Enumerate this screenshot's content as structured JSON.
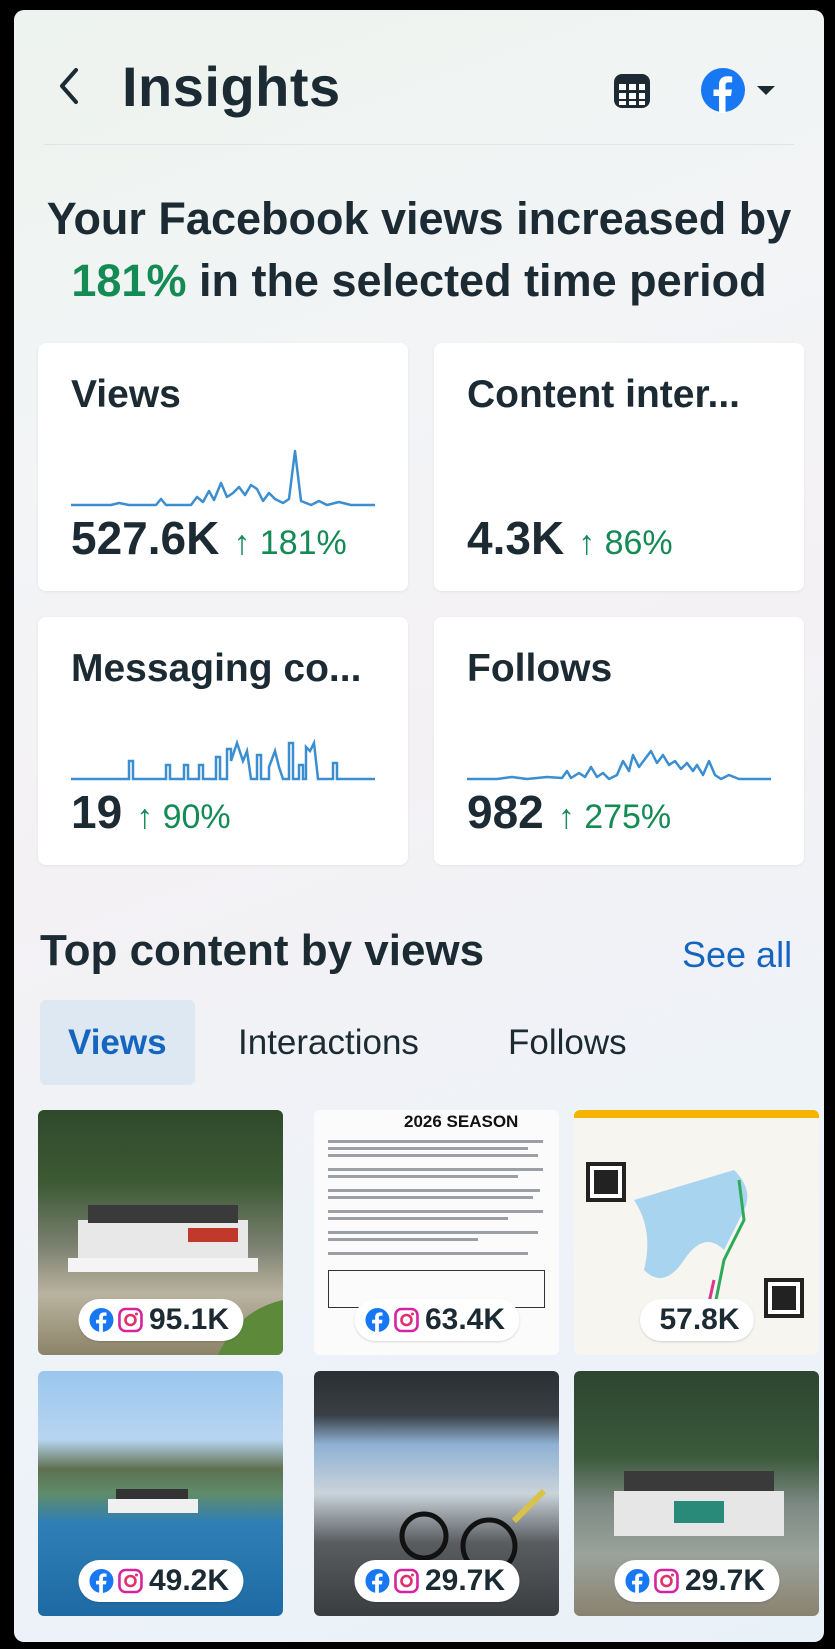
{
  "header": {
    "title": "Insights",
    "icons": [
      "back-chevron-icon",
      "calendar-icon",
      "facebook-icon",
      "caret-down-icon"
    ]
  },
  "headline": {
    "prefix": "Your Facebook views increased by",
    "percent": "181%",
    "suffix": "in the selected time period"
  },
  "metrics": [
    {
      "label": "Views",
      "value": "527.6K",
      "change": "↑ 181%"
    },
    {
      "label": "Content inter...",
      "value": "4.3K",
      "change": "↑ 86%"
    },
    {
      "label": "Messaging co...",
      "value": "19",
      "change": "↑ 90%"
    },
    {
      "label": "Follows",
      "value": "982",
      "change": "↑ 275%"
    }
  ],
  "top_content": {
    "title": "Top content by views",
    "see_all": "See all",
    "tabs": [
      "Views",
      "Interactions",
      "Follows"
    ],
    "active_tab": "Views",
    "items": [
      {
        "views": "95.1K",
        "platforms": [
          "facebook",
          "instagram"
        ]
      },
      {
        "views": "63.4K",
        "platforms": [
          "facebook",
          "instagram"
        ],
        "doc_heading": "2026 SEASON"
      },
      {
        "views": "57.8K",
        "platforms": []
      },
      {
        "views": "49.2K",
        "platforms": [
          "facebook",
          "instagram"
        ]
      },
      {
        "views": "29.7K",
        "platforms": [
          "facebook",
          "instagram"
        ]
      },
      {
        "views": "29.7K",
        "platforms": [
          "facebook",
          "instagram"
        ]
      }
    ]
  },
  "colors": {
    "positive": "#148a54",
    "link": "#1565c0",
    "text": "#1c2b33",
    "sparkline": "#3b8ed0",
    "facebook": "#1877f2"
  }
}
